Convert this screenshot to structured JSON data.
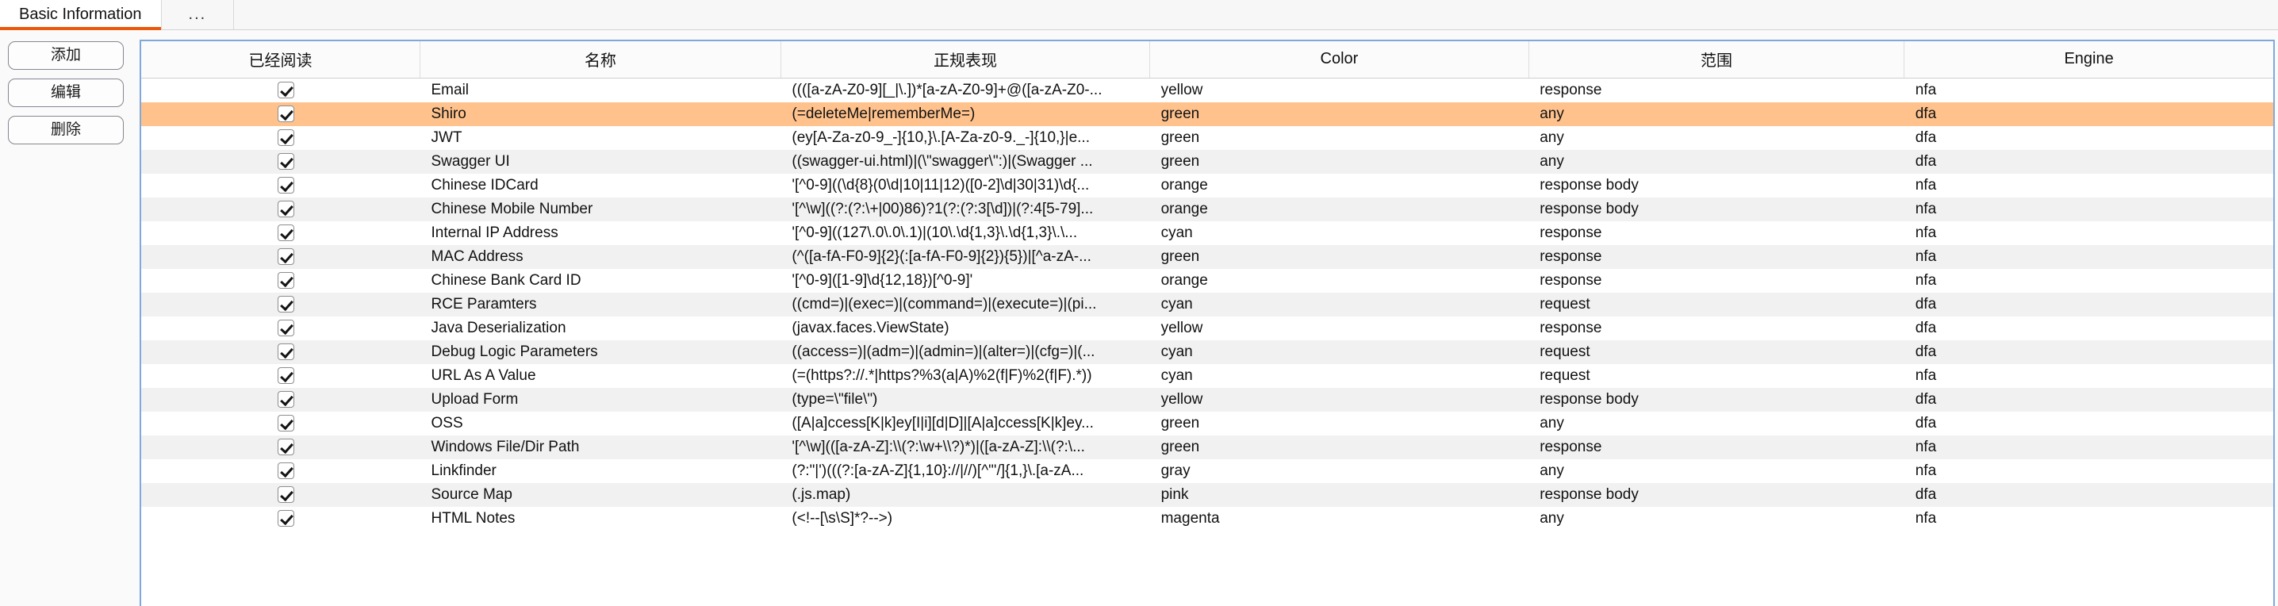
{
  "tabs": [
    {
      "label": "Basic Information",
      "active": true
    },
    {
      "label": "...",
      "active": false
    }
  ],
  "rail": {
    "add_label": "添加",
    "edit_label": "编辑",
    "delete_label": "删除"
  },
  "table": {
    "columns": [
      "已经阅读",
      "名称",
      "正规表现",
      "Color",
      "范围",
      "Engine"
    ],
    "selected_row_index": 1,
    "selected_row_color": "#ffc28d",
    "alt_row_color": "#f1f1f1",
    "rows": [
      {
        "checked": true,
        "name": "Email",
        "regex": "((([a-zA-Z0-9][_|\\.])*[a-zA-Z0-9]+@([a-zA-Z0-...",
        "color": "yellow",
        "scope": "response",
        "engine": "nfa"
      },
      {
        "checked": true,
        "name": "Shiro",
        "regex": "(=deleteMe|rememberMe=)",
        "color": "green",
        "scope": "any",
        "engine": "dfa"
      },
      {
        "checked": true,
        "name": "JWT",
        "regex": "(ey[A-Za-z0-9_-]{10,}\\.[A-Za-z0-9._-]{10,}|e...",
        "color": "green",
        "scope": "any",
        "engine": "dfa"
      },
      {
        "checked": true,
        "name": "Swagger UI",
        "regex": "((swagger-ui.html)|(\\\"swagger\\\":)|(Swagger ...",
        "color": "green",
        "scope": "any",
        "engine": "dfa"
      },
      {
        "checked": true,
        "name": "Chinese IDCard",
        "regex": "'[^0-9]((\\d{8}(0\\d|10|11|12)([0-2]\\d|30|31)\\d{...",
        "color": "orange",
        "scope": "response body",
        "engine": "nfa"
      },
      {
        "checked": true,
        "name": "Chinese Mobile Number",
        "regex": "'[^\\w]((?:(?:\\+|00)86)?1(?:(?:3[\\d])|(?:4[5-79]...",
        "color": "orange",
        "scope": "response body",
        "engine": "nfa"
      },
      {
        "checked": true,
        "name": "Internal IP Address",
        "regex": "'[^0-9]((127\\.0\\.0\\.1)|(10\\.\\d{1,3}\\.\\d{1,3}\\.\\...",
        "color": "cyan",
        "scope": "response",
        "engine": "nfa"
      },
      {
        "checked": true,
        "name": "MAC Address",
        "regex": "(^([a-fA-F0-9]{2}(:[a-fA-F0-9]{2}){5})|[^a-zA-...",
        "color": "green",
        "scope": "response",
        "engine": "nfa"
      },
      {
        "checked": true,
        "name": "Chinese Bank Card ID",
        "regex": "'[^0-9]([1-9]\\d{12,18})[^0-9]'",
        "color": "orange",
        "scope": "response",
        "engine": "nfa"
      },
      {
        "checked": true,
        "name": "RCE Paramters",
        "regex": "((cmd=)|(exec=)|(command=)|(execute=)|(pi...",
        "color": "cyan",
        "scope": "request",
        "engine": "dfa"
      },
      {
        "checked": true,
        "name": "Java Deserialization",
        "regex": "(javax.faces.ViewState)",
        "color": "yellow",
        "scope": "response",
        "engine": "dfa"
      },
      {
        "checked": true,
        "name": "Debug Logic Parameters",
        "regex": "((access=)|(adm=)|(admin=)|(alter=)|(cfg=)|(...",
        "color": "cyan",
        "scope": "request",
        "engine": "dfa"
      },
      {
        "checked": true,
        "name": "URL As A Value",
        "regex": "(=(https?://.*|https?%3(a|A)%2(f|F)%2(f|F).*))",
        "color": "cyan",
        "scope": "request",
        "engine": "nfa"
      },
      {
        "checked": true,
        "name": "Upload Form",
        "regex": "(type=\\\"file\\\")",
        "color": "yellow",
        "scope": "response body",
        "engine": "dfa"
      },
      {
        "checked": true,
        "name": "OSS",
        "regex": "([A|a]ccess[K|k]ey[I|i][d|D]|[A|a]ccess[K|k]ey...",
        "color": "green",
        "scope": "any",
        "engine": "dfa"
      },
      {
        "checked": true,
        "name": "Windows File/Dir Path",
        "regex": "'[^\\w](([a-zA-Z]:\\\\(?:\\w+\\\\?)*)|([a-zA-Z]:\\\\(?:\\...",
        "color": "green",
        "scope": "response",
        "engine": "nfa"
      },
      {
        "checked": true,
        "name": "Linkfinder",
        "regex": "(?:\"|')(((?:[a-zA-Z]{1,10}://|//)[^\"'/]{1,}\\.[a-zA...",
        "color": "gray",
        "scope": "any",
        "engine": "nfa"
      },
      {
        "checked": true,
        "name": "Source Map",
        "regex": "(.js.map)",
        "color": "pink",
        "scope": "response body",
        "engine": "dfa"
      },
      {
        "checked": true,
        "name": "HTML Notes",
        "regex": "(<!--[\\s\\S]*?-->)",
        "color": "magenta",
        "scope": "any",
        "engine": "nfa"
      }
    ]
  }
}
